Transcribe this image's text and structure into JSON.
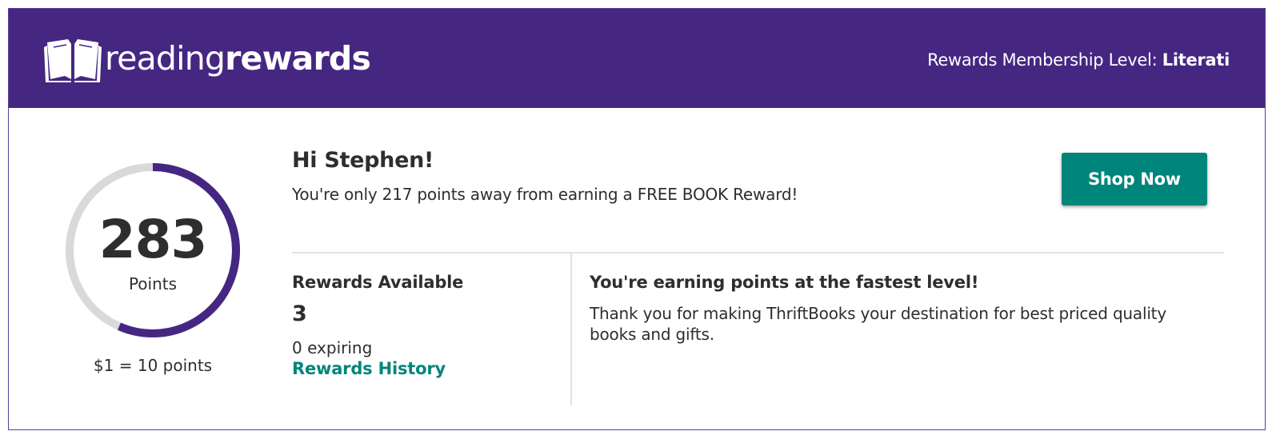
{
  "header": {
    "logo_text_light": "reading",
    "logo_text_bold": "rewards",
    "logo_icon": "open-book-icon",
    "membership_label": "Rewards Membership Level:",
    "membership_level": "Literati",
    "background_color": "#452782"
  },
  "points": {
    "value": "283",
    "label": "Points",
    "progress_fraction": 0.566,
    "conversion": "$1 = 10 points",
    "ring_color": "#452782",
    "track_color": "#d9d9d9"
  },
  "greeting": {
    "title": "Hi Stephen!",
    "message": "You're only 217 points away from earning a FREE BOOK Reward!"
  },
  "shop_button": {
    "label": "Shop Now",
    "color": "#00857a"
  },
  "rewards": {
    "title": "Rewards Available",
    "count": "3",
    "expiring": "0 expiring",
    "history_link": "Rewards History"
  },
  "level_info": {
    "title": "You're earning points at the fastest level!",
    "text": "Thank you for making ThriftBooks your destination for best priced quality books and gifts."
  }
}
